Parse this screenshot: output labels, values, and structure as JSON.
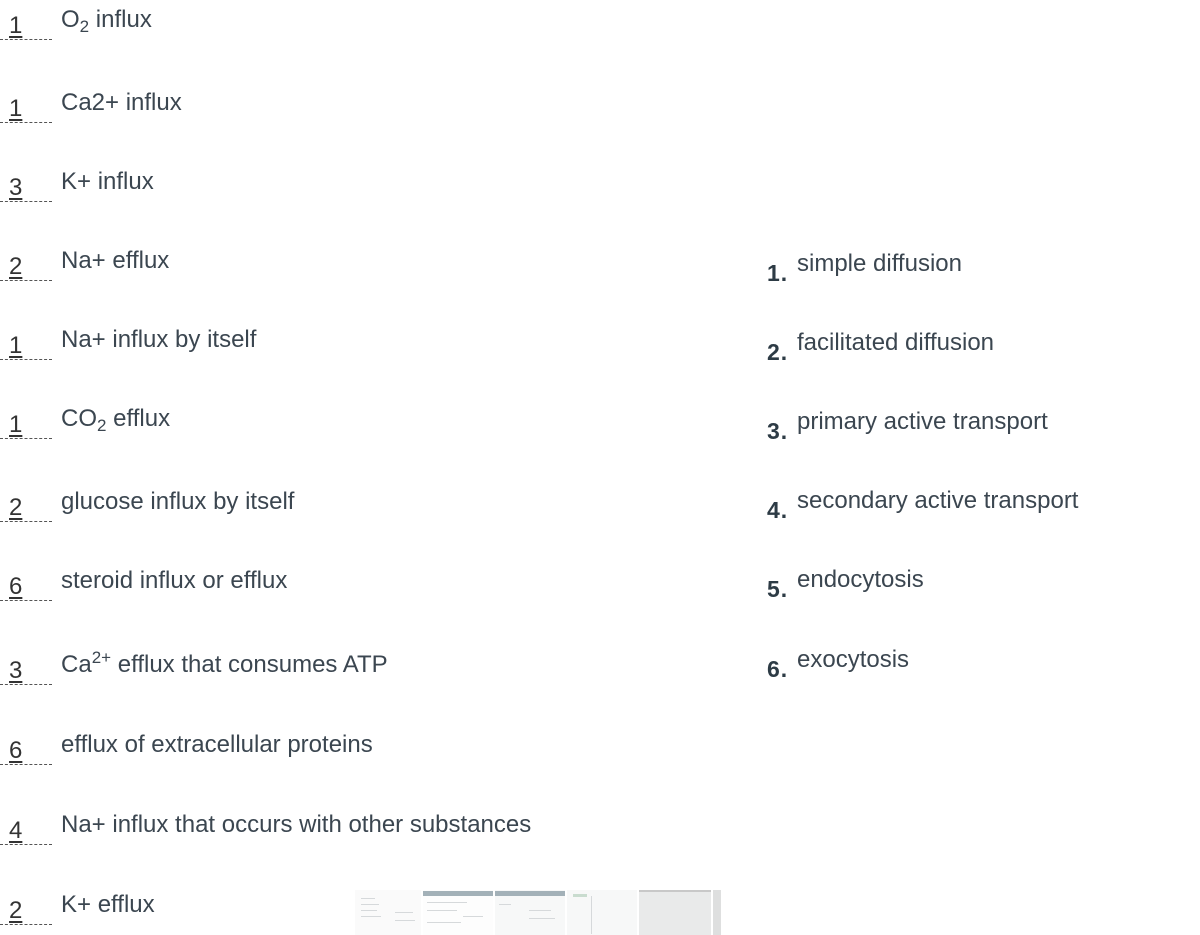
{
  "matching_exercise": {
    "items": [
      {
        "answer": "1",
        "prompt_parts": [
          {
            "t": "O"
          },
          {
            "sub": "2"
          },
          {
            "t": " influx"
          }
        ]
      },
      {
        "answer": "1",
        "prompt_parts": [
          {
            "t": "Ca2+ influx"
          }
        ]
      },
      {
        "answer": "3",
        "prompt_parts": [
          {
            "t": "K+ influx"
          }
        ]
      },
      {
        "answer": "2",
        "prompt_parts": [
          {
            "t": "Na+ efflux"
          }
        ]
      },
      {
        "answer": "1",
        "prompt_parts": [
          {
            "t": "Na+ influx by itself"
          }
        ]
      },
      {
        "answer": "1",
        "prompt_parts": [
          {
            "t": "CO"
          },
          {
            "sub": "2"
          },
          {
            "t": " efflux"
          }
        ]
      },
      {
        "answer": "2",
        "prompt_parts": [
          {
            "t": "glucose influx by itself"
          }
        ]
      },
      {
        "answer": "6",
        "prompt_parts": [
          {
            "t": "steroid influx or efflux"
          }
        ]
      },
      {
        "answer": "3",
        "prompt_parts": [
          {
            "t": "Ca"
          },
          {
            "sup": "2+"
          },
          {
            "t": " efflux that consumes ATP"
          }
        ]
      },
      {
        "answer": "6",
        "prompt_parts": [
          {
            "t": "efflux of extracellular proteins"
          }
        ]
      },
      {
        "answer": "4",
        "prompt_parts": [
          {
            "t": "Na+ influx that occurs with other substances"
          }
        ]
      },
      {
        "answer": "2",
        "prompt_parts": [
          {
            "t": "K+ efflux"
          }
        ]
      }
    ],
    "options": [
      {
        "num": "1.",
        "label": "simple diffusion"
      },
      {
        "num": "2.",
        "label": "facilitated diffusion"
      },
      {
        "num": "3.",
        "label": "primary active transport"
      },
      {
        "num": "4.",
        "label": "secondary active transport"
      },
      {
        "num": "5.",
        "label": "endocytosis"
      },
      {
        "num": "6.",
        "label": "exocytosis"
      }
    ]
  },
  "thumbnails": [
    "thumbnail-1",
    "thumbnail-2",
    "thumbnail-3",
    "thumbnail-4",
    "thumbnail-5",
    "thumbnail-6"
  ]
}
